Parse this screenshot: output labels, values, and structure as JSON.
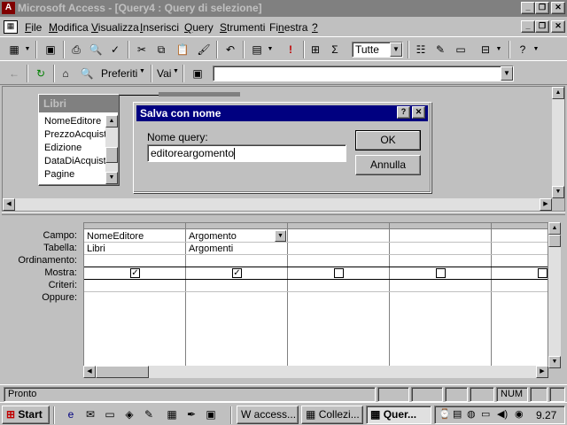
{
  "window": {
    "title": "Microsoft Access - [Query4 : Query di selezione]"
  },
  "menu": {
    "items": [
      {
        "label": "File",
        "u": "F",
        "rest": "ile"
      },
      {
        "label": "Modifica",
        "u": "M",
        "rest": "odifica"
      },
      {
        "label": "Visualizza",
        "u": "V",
        "rest": "isualizza"
      },
      {
        "label": "Inserisci",
        "u": "I",
        "rest": "nserisci"
      },
      {
        "label": "Query",
        "u": "Q",
        "rest": "uery"
      },
      {
        "label": "Strumenti",
        "u": "S",
        "rest": "trumenti"
      },
      {
        "label": "Finestra",
        "u": "F",
        "rest": "inestra"
      },
      {
        "label": "?",
        "u": "?",
        "rest": ""
      }
    ]
  },
  "toolbar1": {
    "topvalues": "Tutte"
  },
  "toolbar2": {
    "favorites": "Preferiti",
    "go": "Vai",
    "address": ""
  },
  "field_list": {
    "title": "Libri",
    "items": [
      "NomeEditore",
      "PrezzoAcquisto",
      "Edizione",
      "DataDiAcquisto",
      "Pagine"
    ]
  },
  "dialog": {
    "title": "Salva con nome",
    "help": "?",
    "close": "✕",
    "label": "Nome query:",
    "value": "editoreargomento",
    "ok": "OK",
    "cancel": "Annulla"
  },
  "qbe": {
    "row_labels": [
      "Campo:",
      "Tabella:",
      "Ordinamento:",
      "Mostra:",
      "Criteri:",
      "Oppure:"
    ],
    "columns": [
      {
        "campo": "NomeEditore",
        "tabella": "Libri",
        "mostra": true
      },
      {
        "campo": "Argomento",
        "tabella": "Argomenti",
        "mostra": true
      },
      {
        "campo": "",
        "tabella": "",
        "mostra": false
      },
      {
        "campo": "",
        "tabella": "",
        "mostra": false
      },
      {
        "campo": "",
        "tabella": "",
        "mostra": false
      }
    ]
  },
  "status": {
    "text": "Pronto",
    "num": "NUM"
  },
  "taskbar": {
    "start": "Start",
    "tasks": [
      "access...",
      "Collezi...",
      "Quer..."
    ],
    "clock": "9.27"
  },
  "colors": {
    "dialog_title": "#000080",
    "inactive_title": "#808080",
    "face": "#c0c0c0"
  }
}
